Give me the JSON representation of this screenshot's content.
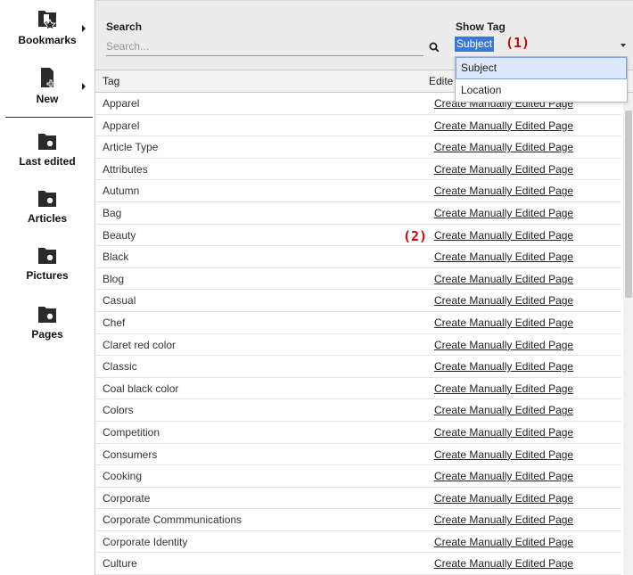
{
  "sidebar": {
    "items": [
      {
        "label": "Bookmarks",
        "icon": "bookmark-folder-icon",
        "has_submenu": true
      },
      {
        "label": "New",
        "icon": "new-document-icon",
        "has_submenu": true
      },
      {
        "label": "Last edited",
        "icon": "folder-search-icon"
      },
      {
        "label": "Articles",
        "icon": "folder-search-icon"
      },
      {
        "label": "Pictures",
        "icon": "folder-search-icon"
      },
      {
        "label": "Pages",
        "icon": "folder-search-icon"
      }
    ]
  },
  "header": {
    "search_label": "Search",
    "search_placeholder": "Search...",
    "show_tag_label": "Show Tag",
    "show_tag_value": "Subject",
    "annotation_1": "(1)",
    "annotation_2": "(2)"
  },
  "dropdown": {
    "options": [
      "Subject",
      "Location"
    ],
    "selected": "Subject"
  },
  "table": {
    "columns": [
      "Tag",
      "Edite"
    ],
    "rows": [
      {
        "tag": "Apparel",
        "action": "Create Manually Edited Page"
      },
      {
        "tag": "Apparel",
        "action": "Create Manually Edited Page"
      },
      {
        "tag": "Article Type",
        "action": "Create Manually Edited Page"
      },
      {
        "tag": "Attributes",
        "action": "Create Manually Edited Page"
      },
      {
        "tag": "Autumn",
        "action": "Create Manually Edited Page"
      },
      {
        "tag": "Bag",
        "action": "Create Manually Edited Page"
      },
      {
        "tag": "Beauty",
        "action": "Create Manually Edited Page"
      },
      {
        "tag": "Black",
        "action": "Create Manually Edited Page"
      },
      {
        "tag": "Blog",
        "action": "Create Manually Edited Page"
      },
      {
        "tag": "Casual",
        "action": "Create Manually Edited Page"
      },
      {
        "tag": "Chef",
        "action": "Create Manually Edited Page"
      },
      {
        "tag": "Claret red color",
        "action": "Create Manually Edited Page"
      },
      {
        "tag": "Classic",
        "action": "Create Manually Edited Page"
      },
      {
        "tag": "Coal black color",
        "action": "Create Manually Edited Page"
      },
      {
        "tag": "Colors",
        "action": "Create Manually Edited Page"
      },
      {
        "tag": "Competition",
        "action": "Create Manually Edited Page"
      },
      {
        "tag": "Consumers",
        "action": "Create Manually Edited Page"
      },
      {
        "tag": "Cooking",
        "action": "Create Manually Edited Page"
      },
      {
        "tag": "Corporate",
        "action": "Create Manually Edited Page"
      },
      {
        "tag": "Corporate Commmunications",
        "action": "Create Manually Edited Page"
      },
      {
        "tag": "Corporate Identity",
        "action": "Create Manually Edited Page"
      },
      {
        "tag": "Culture",
        "action": "Create Manually Edited Page"
      }
    ]
  },
  "colors": {
    "selection": "#3a78d4",
    "annotation": "#d40000",
    "header_bg": "#ececec"
  }
}
